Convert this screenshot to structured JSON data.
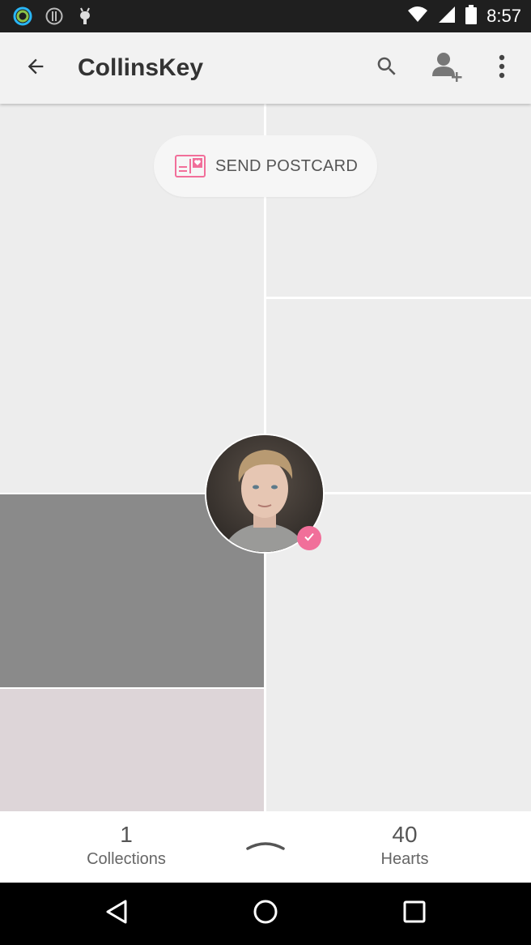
{
  "status_bar": {
    "time": "8:57",
    "left_icons": [
      "ring-app-icon",
      "info-icon",
      "android-icon"
    ],
    "right_icons": [
      "wifi-icon",
      "cell-signal-icon",
      "battery-icon"
    ]
  },
  "app_bar": {
    "title": "CollinsKey",
    "actions": [
      "search-icon",
      "add-person-icon",
      "more-vert-icon"
    ]
  },
  "postcard": {
    "label": "SEND POSTCARD",
    "icon": "postcard-icon"
  },
  "profile": {
    "verified": true,
    "badge_color": "#f16f9a"
  },
  "stats": {
    "collections_count": "1",
    "collections_label": "Collections",
    "hearts_count": "40",
    "hearts_label": "Hearts"
  },
  "colors": {
    "accent": "#f16f9a",
    "tile_light": "#ededed",
    "tile_gray": "#8a8a8a",
    "tile_pink": "#ddd5d8"
  },
  "nav_bar": {
    "buttons": [
      "back-triangle-icon",
      "home-circle-icon",
      "recents-square-icon"
    ]
  }
}
